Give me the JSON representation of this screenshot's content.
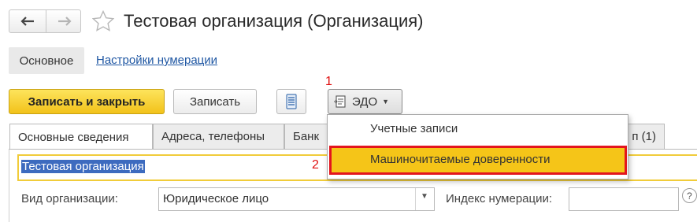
{
  "window": {
    "title": "Тестовая организация (Организация)"
  },
  "nav": {
    "back_icon": "arrow-left",
    "forward_icon": "arrow-right",
    "favorite_icon": "star-outline"
  },
  "sections": {
    "main": "Основное",
    "numbering": "Настройки нумерации"
  },
  "toolbar": {
    "save_close": "Записать и закрыть",
    "save": "Записать",
    "doc_icon": "document-list",
    "edo": "ЭДО",
    "edo_icon": "edo-document",
    "marker1": "1",
    "marker2": "2"
  },
  "tabs": [
    {
      "label": "Основные сведения",
      "active": true
    },
    {
      "label": "Адреса, телефоны",
      "active": false
    },
    {
      "label": "Банк",
      "active": false
    },
    {
      "label": "п (1)",
      "active": false
    }
  ],
  "form": {
    "name_value": "Тестовая организация",
    "org_type_label": "Вид организации:",
    "org_type_value": "Юридическое лицо",
    "index_label": "Индекс нумерации:",
    "index_value": "",
    "help": "?"
  },
  "dropdown": {
    "items": [
      {
        "label": "Учетные записи",
        "highlighted": false
      },
      {
        "label": "Машиночитаемые доверенности",
        "highlighted": true
      }
    ]
  },
  "colors": {
    "accent_yellow": "#f5c518",
    "highlight_border": "#e3151d",
    "link": "#1f57a3",
    "selection": "#3d6bbf"
  }
}
